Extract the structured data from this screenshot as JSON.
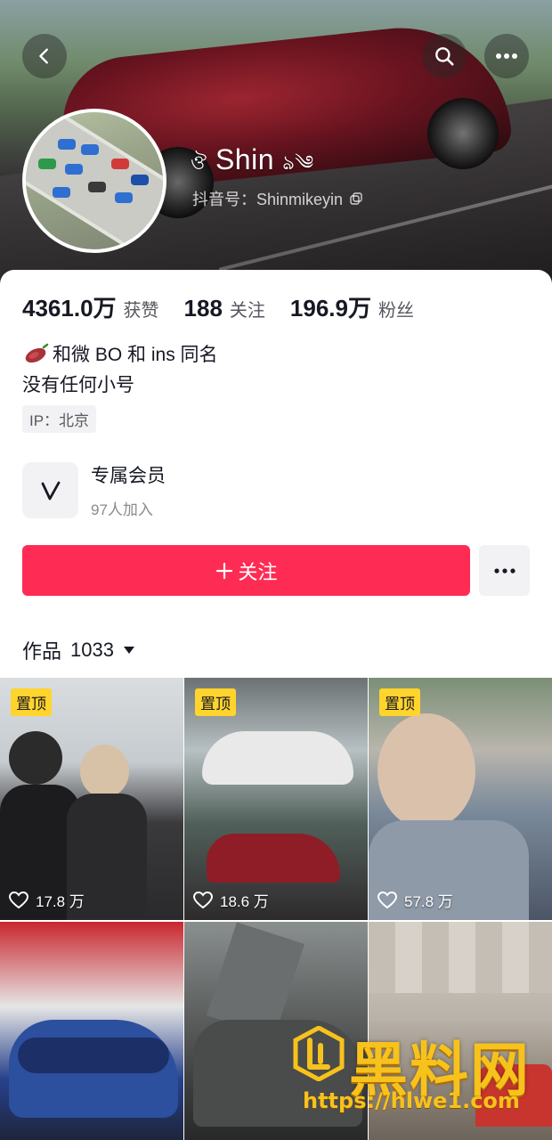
{
  "header": {
    "nickname": "Shin",
    "nickname_prefix": "ঔ",
    "nickname_suffix": "ঌ༄",
    "douyin_id": "抖音号：Shinmikeyin",
    "icons": {
      "back": "chevron-left-icon",
      "search": "search-icon",
      "more": "more-horizontal-icon",
      "copy": "copy-icon"
    }
  },
  "stats": [
    {
      "value": "4361.0万",
      "label": "获赞"
    },
    {
      "value": "188",
      "label": "关注"
    },
    {
      "value": "196.9万",
      "label": "粉丝"
    }
  ],
  "bio": {
    "line1": "和微 BO 和 ins 同名",
    "line2": "没有任何小号",
    "ip": "IP：北京"
  },
  "membership": {
    "title": "专属会员",
    "subtitle": "97人加入"
  },
  "actions": {
    "follow_label": "关注",
    "follow_color": "#fe2c55"
  },
  "works": {
    "label": "作品",
    "count": "1033"
  },
  "videos": [
    {
      "pinned": "置顶",
      "likes": "17.8 万"
    },
    {
      "pinned": "置顶",
      "likes": "18.6 万"
    },
    {
      "pinned": "置顶",
      "likes": "57.8 万"
    },
    {
      "pinned": "",
      "likes": ""
    },
    {
      "pinned": "",
      "likes": ""
    },
    {
      "pinned": "",
      "likes": ""
    }
  ],
  "watermark": {
    "title": "黑料网",
    "url": "https://hlwe1.com"
  }
}
